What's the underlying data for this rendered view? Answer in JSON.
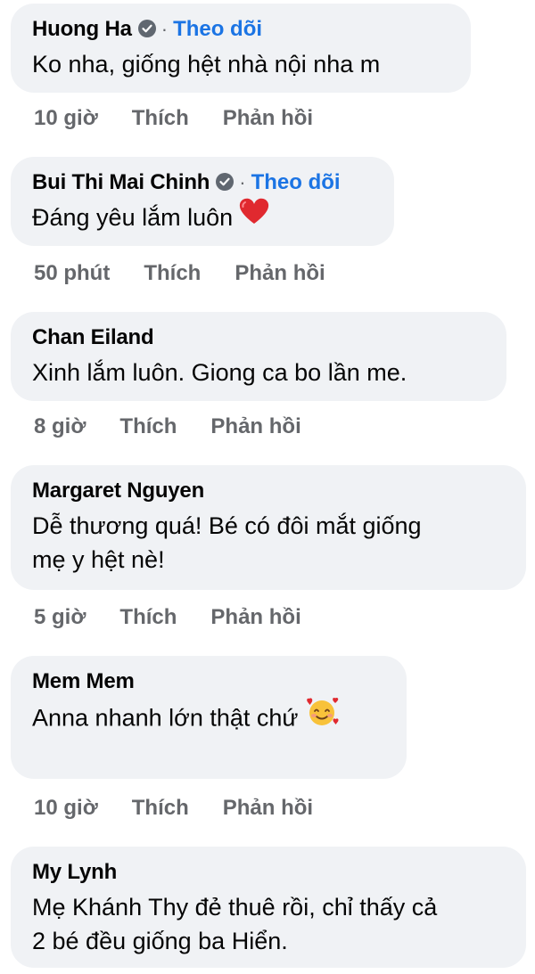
{
  "comments": [
    {
      "name": "Huong Ha",
      "verified": true,
      "follow_label": "Theo dõi",
      "text": "Ko nha, giống hệt nhà nội nha m",
      "time": "10 giờ",
      "like": "Thích",
      "reply": "Phản hồi"
    },
    {
      "name": "Bui Thi Mai Chinh",
      "verified": true,
      "follow_label": "Theo dõi",
      "text": "Đáng yêu lắm luôn",
      "emoji": "red-heart-icon",
      "time": "50 phút",
      "like": "Thích",
      "reply": "Phản hồi"
    },
    {
      "name": "Chan Eiland",
      "text": "Xinh lắm luôn. Giong ca bo lần me.",
      "time": "8 giờ",
      "like": "Thích",
      "reply": "Phản hồi"
    },
    {
      "name": "Margaret Nguyen",
      "text_line1": "Dễ thương quá! Bé có đôi mắt giống",
      "text_line2": "mẹ y hệt nè!",
      "time": "5 giờ",
      "like": "Thích",
      "reply": "Phản hồi"
    },
    {
      "name": "Mem Mem",
      "text": "Anna nhanh lớn thật chứ",
      "emoji": "smiling-face-with-hearts-icon",
      "time": "10 giờ",
      "like": "Thích",
      "reply": "Phản hồi"
    },
    {
      "name": "My Lynh",
      "text_line1": "Mẹ Khánh Thy đẻ thuê rồi, chỉ thấy cả",
      "text_line2": "2 bé đều giống ba Hiển."
    }
  ],
  "colors": {
    "bubble": "#f0f2f5",
    "follow": "#1b74e4",
    "meta": "#65676b",
    "text": "#050505"
  }
}
